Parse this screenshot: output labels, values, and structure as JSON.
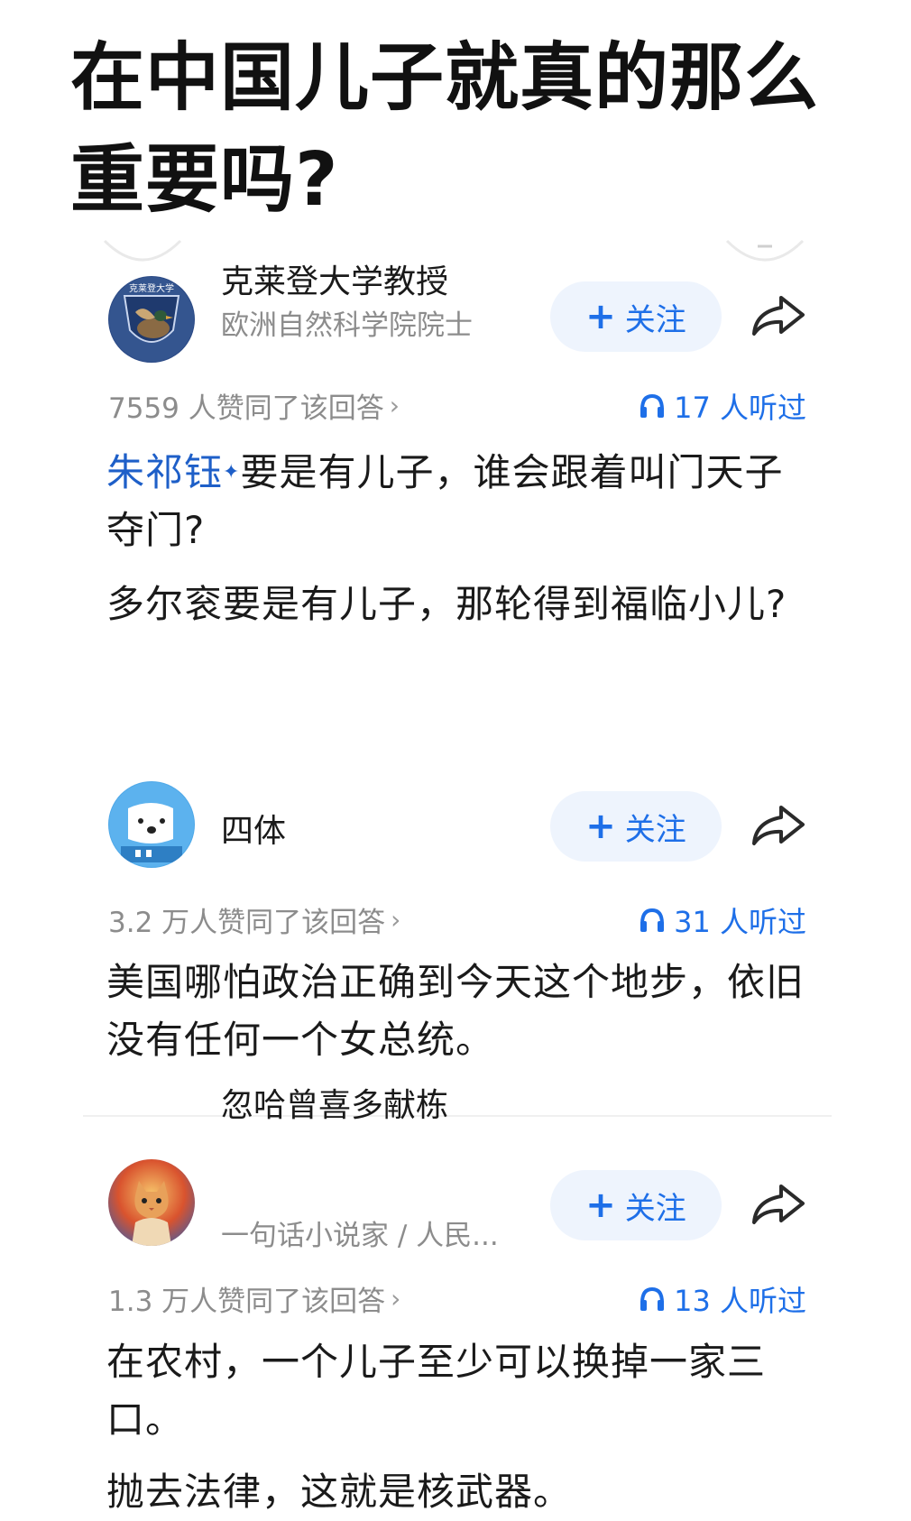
{
  "page_title": "在中国儿子就真的那么重要吗?",
  "follow_label": "关注",
  "answers": [
    {
      "author": "克莱登大学教授",
      "desc": "欧洲自然科学院院士",
      "avatar_icon": "university-duck-logo-icon",
      "avatar_text": "克莱登大学",
      "likes": "7559 人赞同了该回答",
      "listens": "17 人听过",
      "link_name": "朱祁钰",
      "paras": [
        "要是有儿子，谁会跟着叫门天子夺门?",
        "多尔衮要是有儿子，那轮得到福临小儿?"
      ]
    },
    {
      "author": "四体",
      "avatar_icon": "cartoon-dog-icon",
      "likes": "3.2 万人赞同了该回答",
      "listens": "31 人听过",
      "paras": [
        "美国哪怕政治正确到今天这个地步，依旧没有任何一个女总统。"
      ]
    },
    {
      "author": "忽哈曾喜多献栋",
      "desc": "一句话小说家 / 人民...",
      "avatar_icon": "cat-photo-icon",
      "likes": "1.3 万人赞同了该回答",
      "listens": "13 人听过",
      "paras": [
        "在农村，一个儿子至少可以换掉一家三口。",
        "抛去法律，这就是核武器。"
      ]
    }
  ],
  "colors": {
    "accent": "#1e6fe8",
    "link": "#1e5fc8",
    "muted": "#8c8c8c",
    "button_bg": "#eef4fd"
  }
}
